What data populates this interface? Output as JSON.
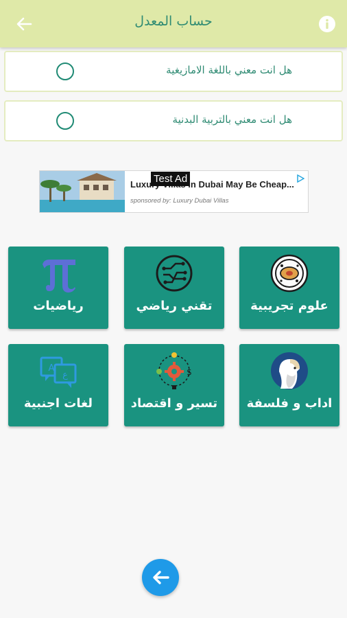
{
  "appbar": {
    "title": "حساب المعدل",
    "back_icon": "arrow-left-icon",
    "info_icon": "info-icon",
    "color": "#dfe9a8"
  },
  "questions": [
    {
      "label": "هل انت معني باللغة الامازيغية",
      "selected": false
    },
    {
      "label": "هل انت معني  بالتربية البدنية",
      "selected": false
    }
  ],
  "ad": {
    "tag": "Test Ad",
    "headline": "Luxury Villas in Dubai May Be Cheap...",
    "sponsor": "sponsored by: Luxury Dubai Villas"
  },
  "tiles": [
    {
      "label": "علوم تجريبية",
      "icon": "microscope-slide-icon"
    },
    {
      "label": "تقني رياضي",
      "icon": "circuit-icon"
    },
    {
      "label": "رياضيات",
      "icon": "pi-icon"
    },
    {
      "label": "اداب و فلسفة",
      "icon": "philosopher-icon"
    },
    {
      "label": "تسير و اقتصاد",
      "icon": "business-gear-icon"
    },
    {
      "label": "لغات اجنبية",
      "icon": "translate-icon"
    }
  ],
  "fab": {
    "icon": "arrow-left-icon",
    "color": "#1f9ae8"
  },
  "colors": {
    "primary": "#1a9380",
    "accent_text": "#2f8b73"
  }
}
